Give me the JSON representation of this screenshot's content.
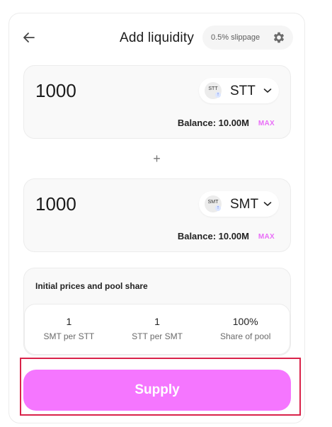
{
  "header": {
    "title": "Add liquidity",
    "slippage_label": "0.5% slippage"
  },
  "token_a": {
    "amount": "1000",
    "symbol": "STT",
    "logo_text": "STT",
    "balance": "Balance: 10.00M",
    "max_label": "MAX"
  },
  "plus_sign": "+",
  "token_b": {
    "amount": "1000",
    "symbol": "SMT",
    "logo_text": "SMT",
    "balance": "Balance: 10.00M",
    "max_label": "MAX"
  },
  "prices": {
    "title": "Initial prices and pool share",
    "items": [
      {
        "value": "1",
        "label": "SMT per STT"
      },
      {
        "value": "1",
        "label": "STT per SMT"
      },
      {
        "value": "100%",
        "label": "Share of pool"
      }
    ]
  },
  "supply_label": "Supply",
  "colors": {
    "accent": "#f576ff",
    "max": "#e96ef8",
    "highlight": "#d9234a"
  },
  "icons": {
    "back": "arrow-left-icon",
    "settings": "gear-icon",
    "dropdown": "chevron-down-icon"
  }
}
